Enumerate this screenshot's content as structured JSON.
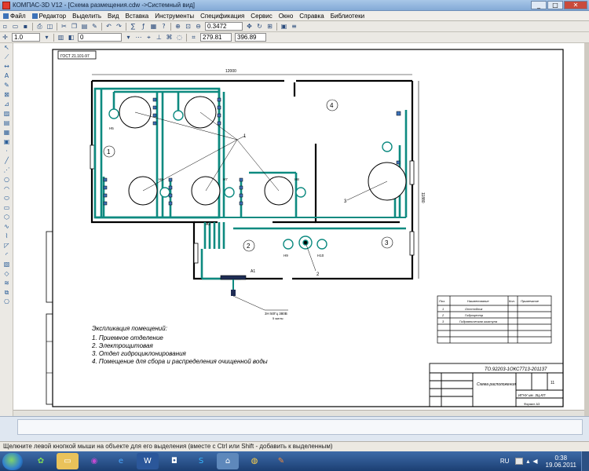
{
  "window": {
    "title": "КОМПАС-3D V12 - [Схема размещения.cdw ->Системный вид]",
    "buttons": [
      "_",
      "□",
      "✕"
    ]
  },
  "menu": [
    "Файл",
    "Редактор",
    "Выделить",
    "Вид",
    "Вставка",
    "Инструменты",
    "Спецификация",
    "Сервис",
    "Окно",
    "Справка",
    "Библиотеки"
  ],
  "toolbar": {
    "zoom_value": "0.3472",
    "line_scale": "1.0",
    "layer": "0",
    "coord_x": "279.81",
    "coord_y": "396.89"
  },
  "drawing": {
    "stamp_top": "ГОСТ 21.101-97",
    "room_numbers": [
      "1",
      "2",
      "3",
      "4"
    ],
    "equip_labels": [
      "Н5",
      "Н6",
      "Н7",
      "Н8",
      "Н9",
      "Н10"
    ],
    "leader_numbers": [
      "1",
      "2",
      "3"
    ],
    "dim_top": "12000",
    "dim_right": "11880",
    "label_a1": "А1",
    "label_a2": "А2",
    "power_label": "3Н 50Гц 380В",
    "power_sub": "5 жилы",
    "explication_title": "Экспликация помещений:",
    "explication": [
      "1. Приемное отделение",
      "2. Электрощитовая",
      "3. Отдел гидроциклонирования",
      "4. Помещение для сбора и распределения очищенной воды"
    ],
    "table_header": {
      "pos": "Поз.",
      "name": "Наименование",
      "qty": "Кол.",
      "note": "Примечание"
    },
    "table_rows": [
      {
        "pos": "1",
        "name": "Отстойник"
      },
      {
        "pos": "2",
        "name": "Гидроцентр"
      },
      {
        "pos": "3",
        "name": "Гидравлическая шкатула"
      }
    ],
    "doc_code": "ТО.92203-1ОКС7713-201137",
    "sheet_title": "Схема расположения",
    "org": "ИГНУ им. ЗЦ.КП",
    "sheet_no": "11",
    "format_label": "Формат А3"
  },
  "status": {
    "text": "Щелкните левой кнопкой мыши на объекте для его выделения (вместе с Ctrl или Shift - добавить к выделенным)"
  },
  "taskbar": {
    "lang": "RU",
    "time": "0:38",
    "date": "19.06.2011"
  },
  "colors": {
    "pipe": "#0d8a80",
    "accent": "#3d72b8"
  }
}
